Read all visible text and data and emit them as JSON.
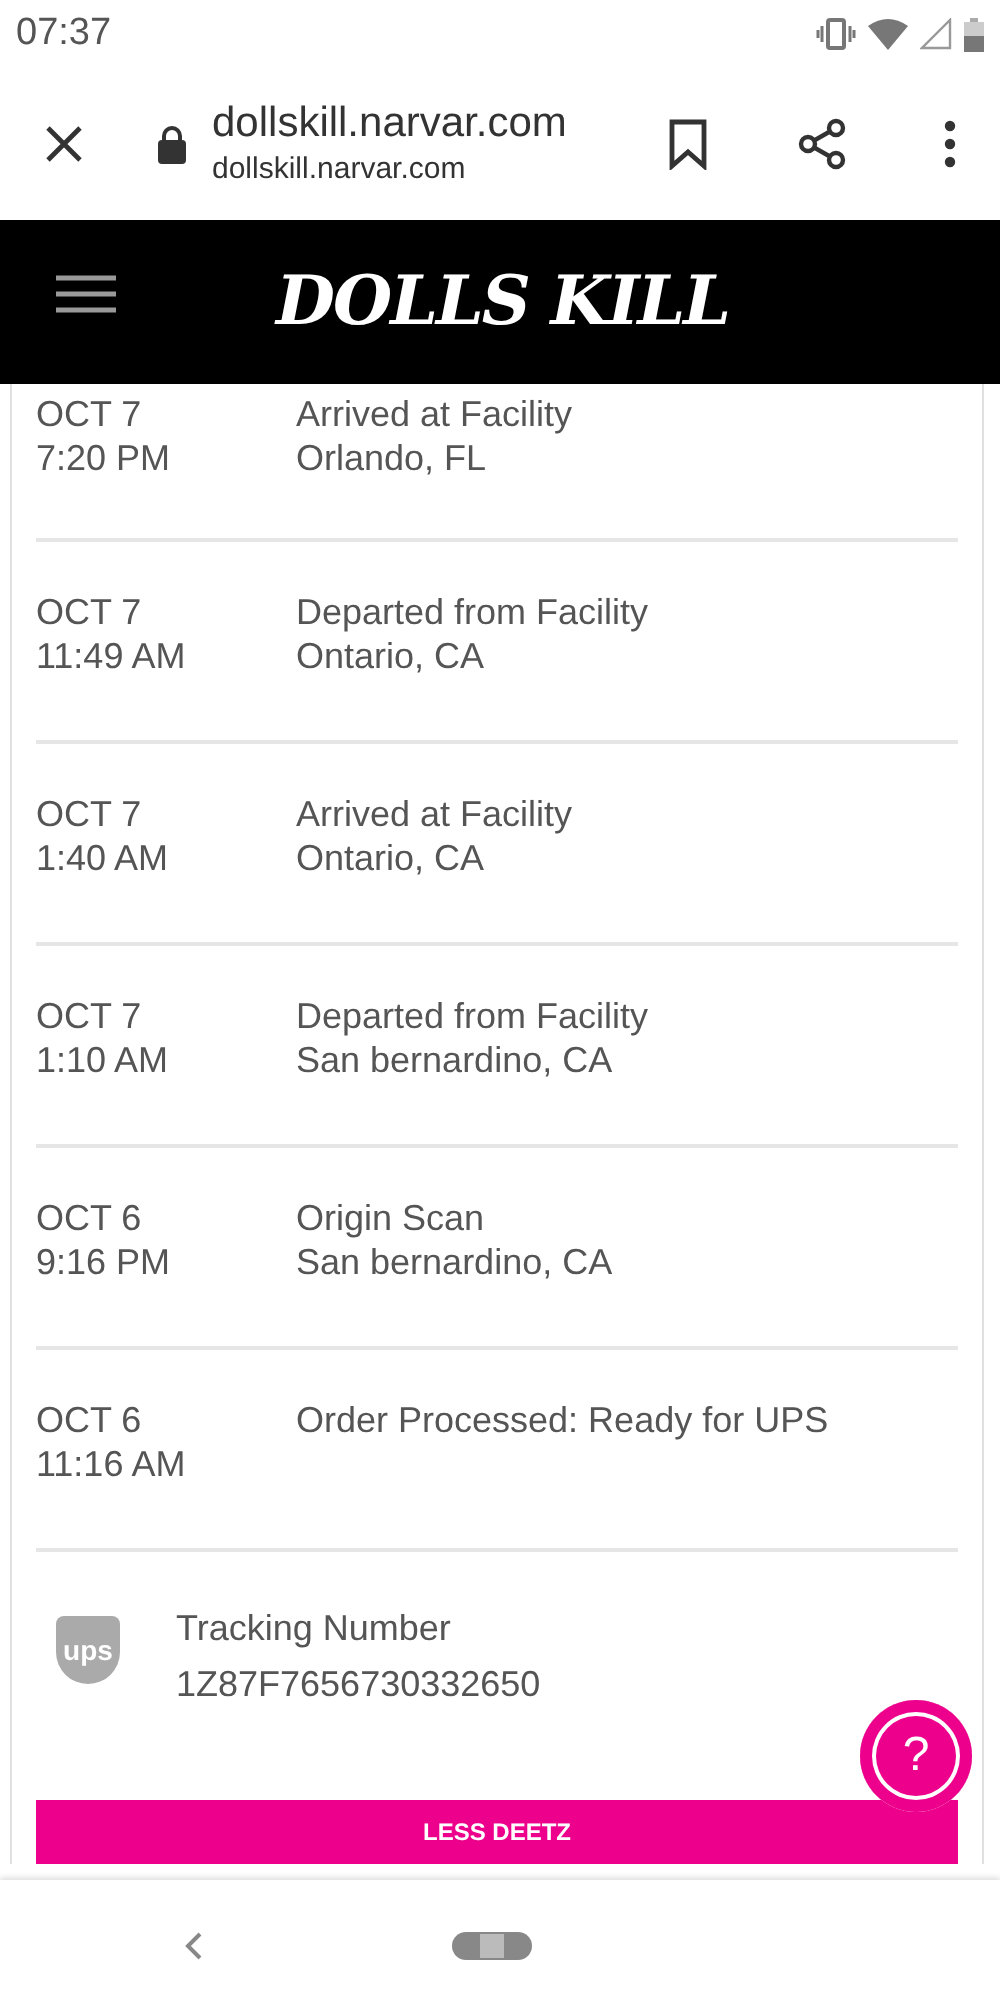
{
  "status_bar": {
    "time": "07:37"
  },
  "browser": {
    "title": "dollskill.narvar.com",
    "url": "dollskill.narvar.com"
  },
  "site_header": {
    "logo": "DOLLS KILL"
  },
  "events": [
    {
      "date": "OCT 7",
      "time": "7:20 PM",
      "status": "Arrived at Facility",
      "location": "Orlando, FL"
    },
    {
      "date": "OCT 7",
      "time": "11:49 AM",
      "status": "Departed from Facility",
      "location": "Ontario, CA"
    },
    {
      "date": "OCT 7",
      "time": "1:40 AM",
      "status": "Arrived at Facility",
      "location": "Ontario, CA"
    },
    {
      "date": "OCT 7",
      "time": "1:10 AM",
      "status": "Departed from Facility",
      "location": "San bernardino, CA"
    },
    {
      "date": "OCT 6",
      "time": "9:16 PM",
      "status": "Origin Scan",
      "location": "San bernardino, CA"
    },
    {
      "date": "OCT 6",
      "time": "11:16 AM",
      "status": "Order Processed: Ready for UPS"
    }
  ],
  "tracking": {
    "carrier_logo": "ups",
    "label": "Tracking Number",
    "number": "1Z87F7656730332650"
  },
  "help_button": {
    "label": "?"
  },
  "less_button": {
    "label": "LESS DEETZ"
  }
}
